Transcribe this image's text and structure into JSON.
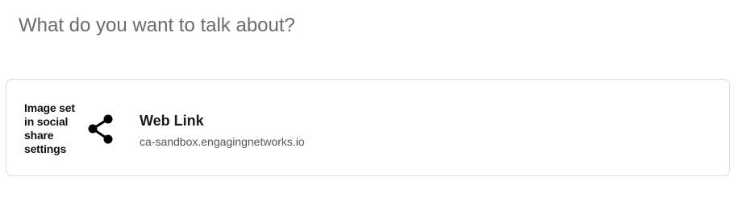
{
  "composer": {
    "prompt_placeholder": "What do you want to talk about?"
  },
  "link_preview": {
    "thumbnail_text": "Image set in social share settings",
    "thumbnail_icon": "share-icon",
    "title": "Web Link",
    "domain": "ca-sandbox.engagingnetworks.io"
  }
}
